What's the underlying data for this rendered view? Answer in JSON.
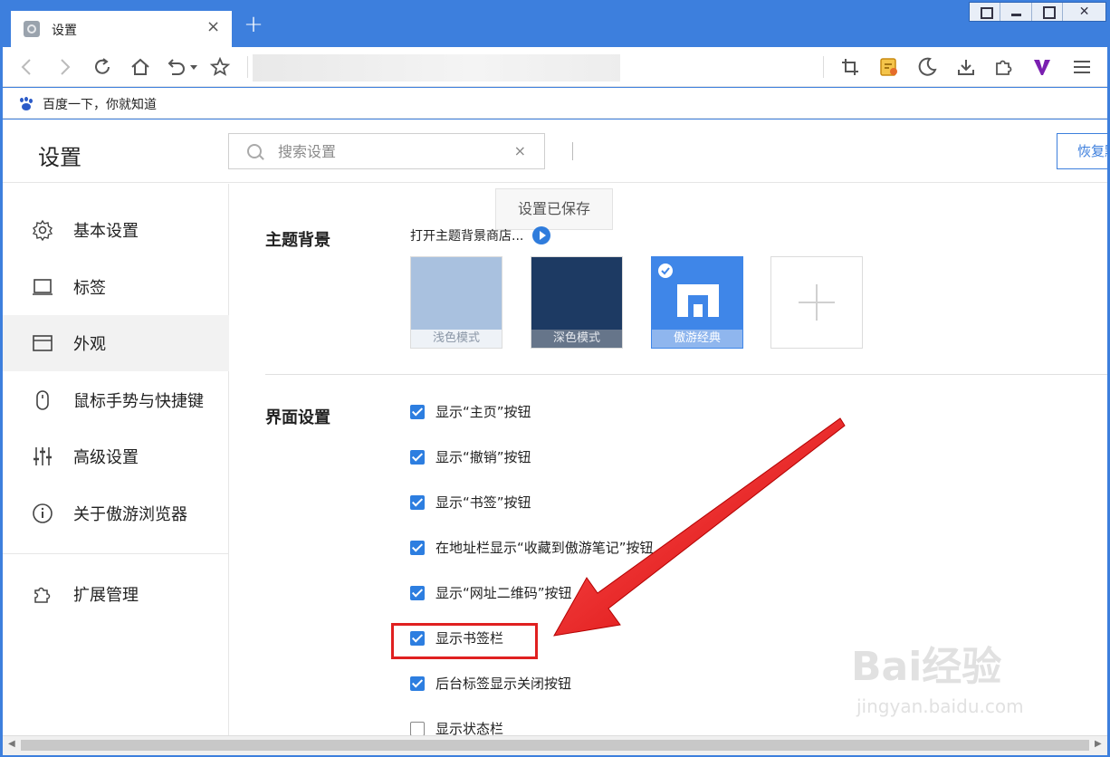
{
  "window": {
    "tab_title": "设置",
    "tab_close": "×",
    "new_tab": "+",
    "controls": {
      "close": "✕"
    }
  },
  "bookmarks_bar": {
    "items": [
      {
        "label": "百度一下，你就知道",
        "icon": "baidu-paw-icon"
      }
    ]
  },
  "header": {
    "title": "设置",
    "search_placeholder": "搜索设置",
    "search_clear": "×",
    "restore_label": "恢复默认设置"
  },
  "sidebar": {
    "items": [
      {
        "label": "基本设置",
        "icon": "gear-icon",
        "active": false
      },
      {
        "label": "标签",
        "icon": "tab-icon",
        "active": false
      },
      {
        "label": "外观",
        "icon": "window-icon",
        "active": true
      },
      {
        "label": "鼠标手势与快捷键",
        "icon": "mouse-icon",
        "active": false
      },
      {
        "label": "高级设置",
        "icon": "sliders-icon",
        "active": false
      },
      {
        "label": "关于傲游浏览器",
        "icon": "info-icon",
        "active": false
      },
      {
        "label": "扩展管理",
        "icon": "puzzle-icon",
        "active": false
      }
    ]
  },
  "toast": "设置已保存",
  "theme": {
    "section_title": "主题背景",
    "store_link": "打开主题背景商店...",
    "thumbnails": [
      {
        "label": "浅色模式",
        "selected": false,
        "color": "#a9c1df"
      },
      {
        "label": "深色模式",
        "selected": false,
        "color": "#1d3a63"
      },
      {
        "label": "傲游经典",
        "selected": true,
        "color": "#3f86e8"
      },
      {
        "label": "",
        "add": true
      }
    ]
  },
  "interface": {
    "section_title": "界面设置",
    "options": [
      {
        "label": "显示“主页”按钮",
        "checked": true
      },
      {
        "label": "显示“撤销”按钮",
        "checked": true
      },
      {
        "label": "显示“书签”按钮",
        "checked": true
      },
      {
        "label": "在地址栏显示“收藏到傲游笔记”按钮",
        "checked": true
      },
      {
        "label": "显示“网址二维码”按钮",
        "checked": true
      },
      {
        "label": "显示书签栏",
        "checked": true
      },
      {
        "label": "后台标签显示关闭按钮",
        "checked": true
      },
      {
        "label": "显示状态栏",
        "checked": false
      }
    ]
  },
  "watermark": {
    "brand": "Bai经验",
    "url": "jingyan.baidu.com"
  },
  "colors": {
    "accent": "#3d7fdd",
    "checkbox": "#2d7ee0",
    "annotation": "#e02020"
  }
}
